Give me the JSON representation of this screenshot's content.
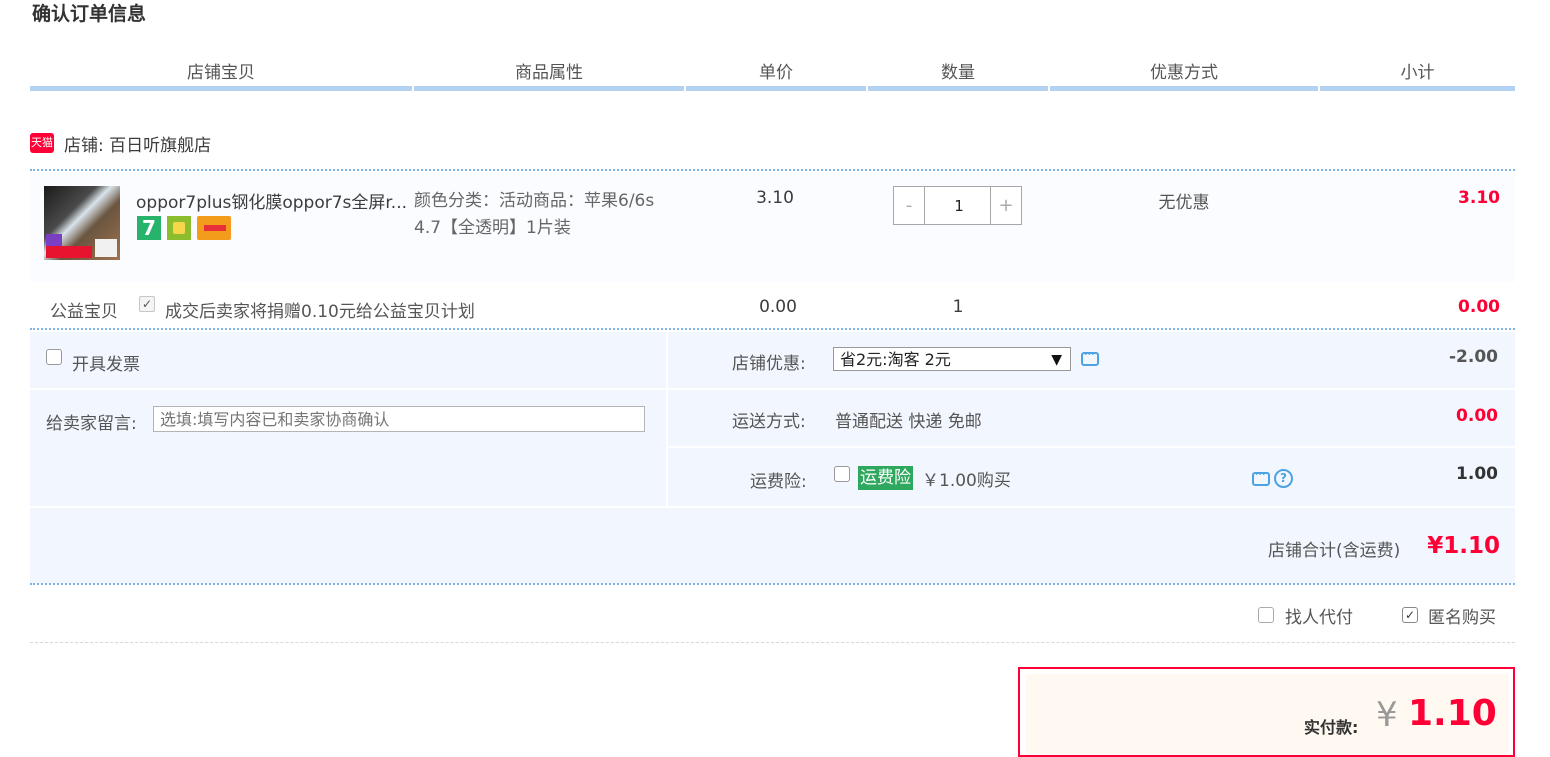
{
  "page_title": "确认订单信息",
  "table_headers": [
    "店铺宝贝",
    "商品属性",
    "单价",
    "数量",
    "优惠方式",
    "小计"
  ],
  "shop": {
    "badge": "天猫",
    "label": "店铺: 百日听旗舰店"
  },
  "item": {
    "name": "oppor7plus钢化膜oppor7s全屏r...",
    "badge_7": "7",
    "sku_lines": [
      "颜色分类：活动商品：苹果6/6s",
      "4.7【全透明】1片装"
    ],
    "price": "3.10",
    "quantity": "1",
    "minus": "-",
    "plus": "+",
    "discount": "无优惠",
    "subtotal": "3.10"
  },
  "charity": {
    "label": "公益宝贝",
    "check_mark": "✓",
    "text": "成交后卖家将捐赠0.10元给公益宝贝计划",
    "price": "0.00",
    "quantity": "1",
    "subtotal": "0.00"
  },
  "invoice": {
    "label": "开具发票"
  },
  "message": {
    "label": "给卖家留言:",
    "placeholder": "选填:填写内容已和卖家协商确认"
  },
  "shop_discount": {
    "label": "店铺优惠:",
    "selected": "省2元:淘客 2元",
    "arrow": "▼",
    "amount": "-2.00"
  },
  "shipping": {
    "label": "运送方式:",
    "value": "普通配送 快递 免邮",
    "amount": "0.00"
  },
  "insurance": {
    "label": "运费险:",
    "badge": "运费险",
    "text": "￥1.00购买",
    "help": "?",
    "amount": "1.00"
  },
  "shop_total": {
    "label": "店铺合计(含运费)",
    "value": "¥1.10"
  },
  "options": {
    "proxy_pay": "找人代付",
    "anonymous": "匿名购买",
    "check_mark": "✓"
  },
  "payment": {
    "label": "实付款:",
    "symbol": "¥",
    "value": "1.10"
  },
  "colors": {
    "accent_red": "#ff0036",
    "header_bar": "#b2d1f3",
    "panel_bg": "#f2f7ff",
    "insurance_green": "#2fa85f"
  }
}
